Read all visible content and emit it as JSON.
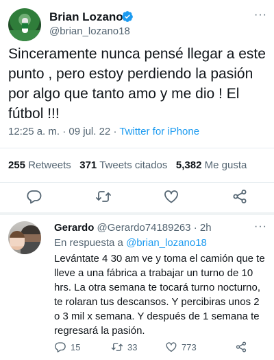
{
  "main_tweet": {
    "author_name": "Brian Lozano",
    "handle": "@brian_lozano18",
    "more_glyph": "···",
    "text": "Sinceramente nunca pensé llegar a este punto , pero estoy perdiendo la pasión por algo que tanto amo y me dio ! El fútbol !!!",
    "time": "12:25 a. m.",
    "separator": " · ",
    "date": "09 jul. 22",
    "source": "Twitter for iPhone",
    "stats": {
      "retweets_count": "255",
      "retweets_label": "Retweets",
      "quotes_count": "371",
      "quotes_label": "Tweets citados",
      "likes_count": "5,382",
      "likes_label": "Me gusta"
    },
    "actions": [
      "reply-icon",
      "retweet-icon",
      "like-icon",
      "share-icon"
    ]
  },
  "reply_tweet": {
    "author_name": "Gerardo",
    "handle": "@Gerardo74189263",
    "age": "· 2h",
    "more_glyph": "···",
    "in_reply_prefix": "En respuesta a ",
    "in_reply_handle": "@brian_lozano18",
    "text": "Levántate 4 30 am ve y toma el camión que te lleve a una fábrica a trabajar un turno de 10 hrs. La otra semana te tocará turno nocturno, te rolaran tus descansos. Y percibiras unos 2 o 3 mil x semana.  Y después de 1 semana te regresará la pasión.",
    "replies": "15",
    "retweets": "33",
    "likes": "773"
  },
  "colors": {
    "text": "#0f1419",
    "muted": "#536471",
    "link": "#1d9bf0",
    "divider": "#e6ecf0"
  }
}
